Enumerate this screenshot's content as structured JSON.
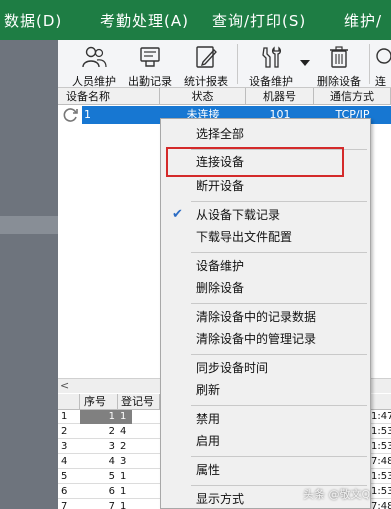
{
  "menubar": {
    "items": [
      "数据(D)",
      "考勤处理(A)",
      "查询/打印(S)",
      "维护/"
    ]
  },
  "toolbar": {
    "tools": [
      {
        "label": "人员维护",
        "icon": "people-icon"
      },
      {
        "label": "出勤记录",
        "icon": "attendance-record-icon"
      },
      {
        "label": "统计报表",
        "icon": "report-edit-icon"
      },
      {
        "label": "设备维护",
        "icon": "device-maintenance-icon"
      },
      {
        "label": "删除设备",
        "icon": "trash-icon"
      },
      {
        "label": "连",
        "icon": "connect-icon"
      }
    ]
  },
  "device_grid": {
    "headers": [
      "设备名称",
      "状态",
      "机器号",
      "通信方式"
    ],
    "rows": [
      {
        "name": "1",
        "status": "未连接",
        "machine_no": "101",
        "comm": "TCP/IP"
      }
    ]
  },
  "record_grid": {
    "headers": [
      "序号",
      "登记号"
    ],
    "rows": [
      {
        "seq": "1",
        "id": "1",
        "time": "1:47"
      },
      {
        "seq": "2",
        "id": "4",
        "time": "1:53"
      },
      {
        "seq": "3",
        "id": "2",
        "time": "1:53"
      },
      {
        "seq": "4",
        "id": "3",
        "time": "7:48"
      },
      {
        "seq": "5",
        "id": "1",
        "time": "1:53"
      },
      {
        "seq": "6",
        "id": "1",
        "time": "1:53"
      },
      {
        "seq": "7",
        "id": "1",
        "time": "7:48"
      }
    ]
  },
  "context_menu": {
    "items": [
      {
        "label": "选择全部"
      },
      {
        "label": "连接设备",
        "highlighted": true
      },
      {
        "label": "断开设备"
      },
      {
        "label": "从设备下载记录",
        "checked": true
      },
      {
        "label": "下载导出文件配置"
      },
      {
        "label": "设备维护"
      },
      {
        "label": "删除设备"
      },
      {
        "label": "清除设备中的记录数据"
      },
      {
        "label": "清除设备中的管理记录"
      },
      {
        "label": "同步设备时间"
      },
      {
        "label": "刷新"
      },
      {
        "label": "禁用"
      },
      {
        "label": "启用"
      },
      {
        "label": "属性"
      },
      {
        "label": "显示方式"
      }
    ]
  },
  "watermark": "头条 @敬文Q",
  "colors": {
    "menubar": "#1e7d44",
    "selection": "#1777d2",
    "highlight_box": "#d42a2a"
  }
}
